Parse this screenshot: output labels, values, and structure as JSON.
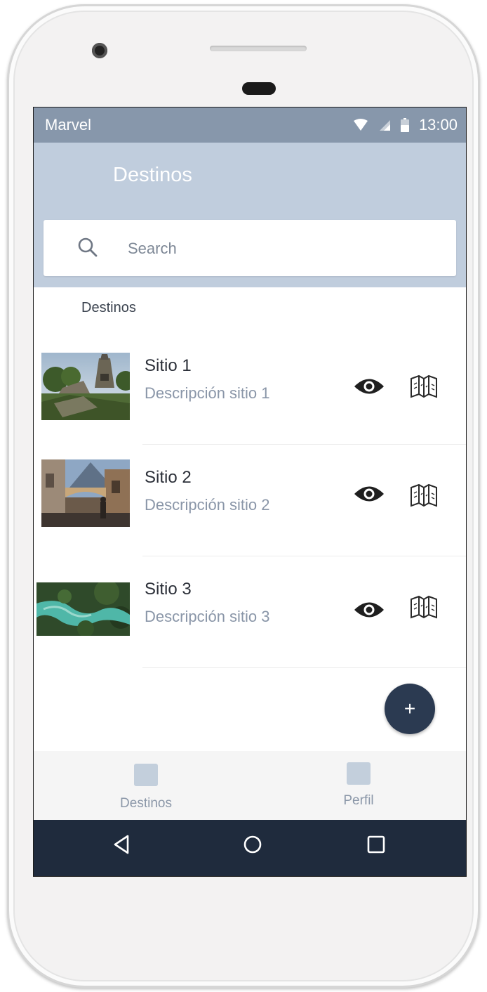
{
  "status_bar": {
    "carrier": "Marvel",
    "time": "13:00",
    "icons": [
      "wifi-icon",
      "signal-icon",
      "battery-icon"
    ]
  },
  "app_bar": {
    "title": "Destinos"
  },
  "search": {
    "placeholder": "Search",
    "value": ""
  },
  "section": {
    "header": "Destinos"
  },
  "destinations": [
    {
      "title": "Sitio 1",
      "description": "Descripción sitio 1"
    },
    {
      "title": "Sitio 2",
      "description": "Descripción sitio 2"
    },
    {
      "title": "Sitio 3",
      "description": "Descripción sitio 3"
    }
  ],
  "fab": {
    "label": "+"
  },
  "bottom_nav": {
    "tabs": [
      {
        "label": "Destinos"
      },
      {
        "label": "Perfil"
      }
    ]
  },
  "colors": {
    "status_bar": "#8797ab",
    "app_bar": "#c0cddd",
    "fab": "#2b3a51",
    "system_nav": "#1f2b3d"
  }
}
